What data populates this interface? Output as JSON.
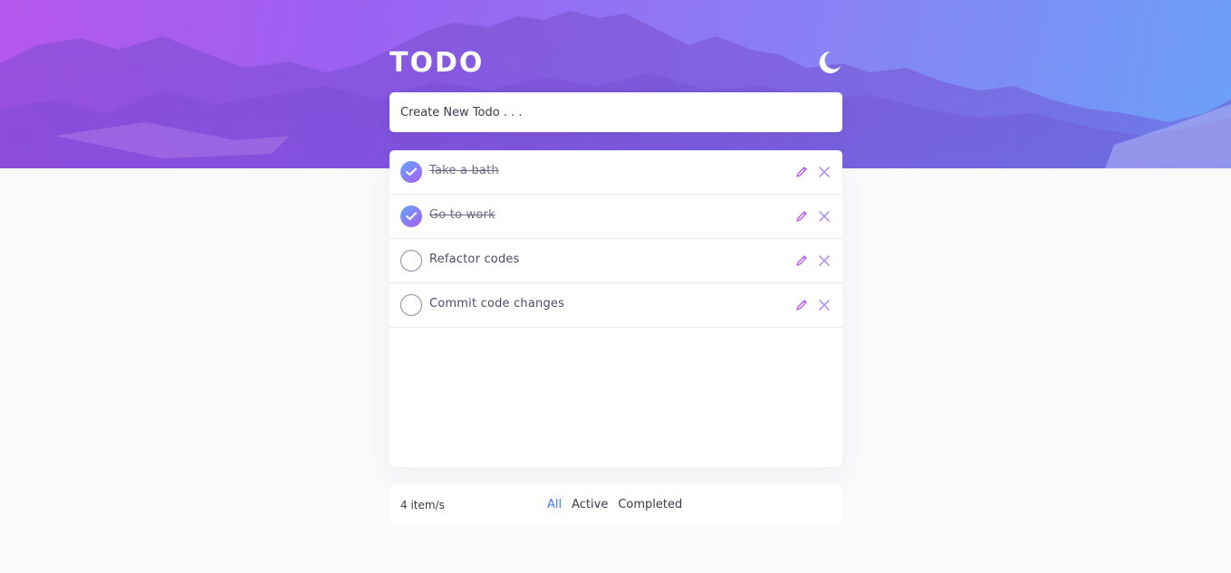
{
  "header": {
    "title": "TODO",
    "theme_icon": "moon-icon"
  },
  "new_todo": {
    "placeholder": "Create New Todo . . .",
    "value": ""
  },
  "todos": [
    {
      "label": "Take a bath",
      "completed": true
    },
    {
      "label": "Go to work",
      "completed": true
    },
    {
      "label": "Refactor codes",
      "completed": false
    },
    {
      "label": "Commit code changes",
      "completed": false
    }
  ],
  "icons": {
    "check": "check-icon",
    "edit": "pencil-icon",
    "delete": "close-icon"
  },
  "footer": {
    "count": "4 item/s",
    "filters": [
      "All",
      "Active",
      "Completed"
    ],
    "active_filter": "All"
  },
  "colors": {
    "accent_blue": "#3a7bfd",
    "check_gradient_start": "#5fa8ff",
    "check_gradient_end": "#ac5cf0",
    "icon_pink": "#c058f3"
  }
}
